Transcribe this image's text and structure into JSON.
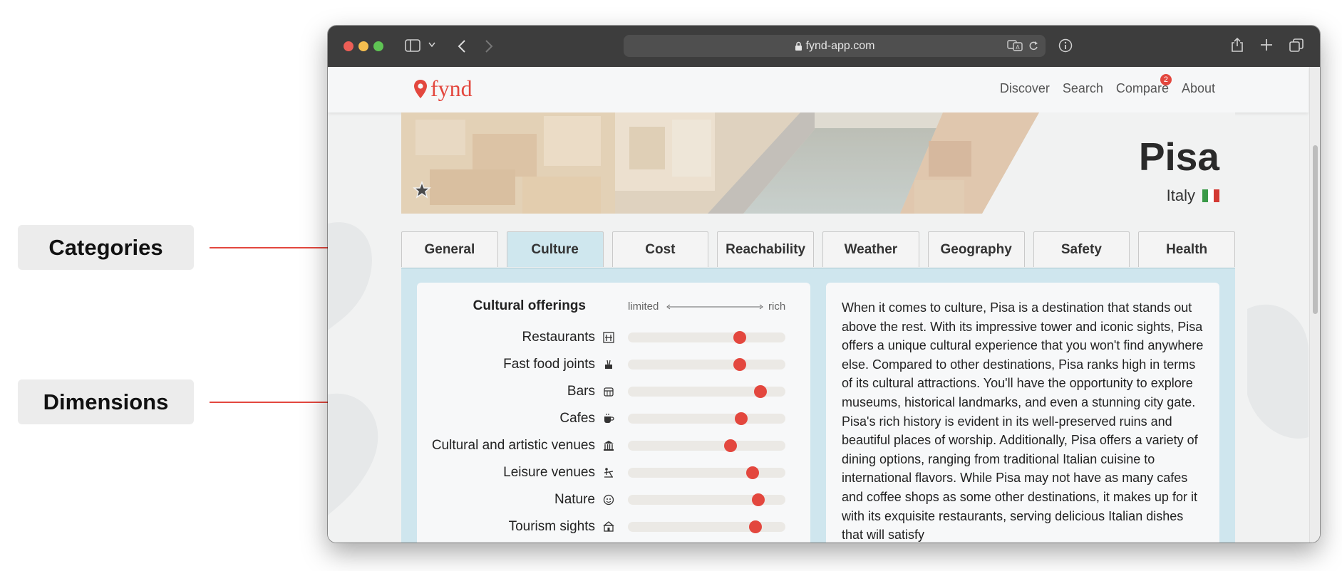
{
  "annotations": {
    "categories_label": "Categories",
    "dimensions_label": "Dimensions"
  },
  "browser": {
    "url": "fynd-app.com"
  },
  "site": {
    "logo_text": "fynd",
    "nav": [
      {
        "label": "Discover"
      },
      {
        "label": "Search"
      },
      {
        "label": "Compare",
        "badge": "2"
      },
      {
        "label": "About"
      }
    ]
  },
  "destination": {
    "city": "Pisa",
    "country": "Italy",
    "flag_colors": [
      "#3a9a48",
      "#ffffff",
      "#d33a34"
    ]
  },
  "tabs": [
    {
      "label": "General",
      "active": false
    },
    {
      "label": "Culture",
      "active": true
    },
    {
      "label": "Cost",
      "active": false
    },
    {
      "label": "Reachability",
      "active": false
    },
    {
      "label": "Weather",
      "active": false
    },
    {
      "label": "Geography",
      "active": false
    },
    {
      "label": "Safety",
      "active": false
    },
    {
      "label": "Health",
      "active": false
    }
  ],
  "offerings": {
    "title": "Cultural offerings",
    "scale_min": "limited",
    "scale_max": "rich",
    "dimensions": [
      {
        "label": "Restaurants",
        "icon": "restaurant-icon",
        "value": 0.71
      },
      {
        "label": "Fast food joints",
        "icon": "fast-food-icon",
        "value": 0.71
      },
      {
        "label": "Bars",
        "icon": "bar-icon",
        "value": 0.84
      },
      {
        "label": "Cafes",
        "icon": "coffee-cup-icon",
        "value": 0.72
      },
      {
        "label": "Cultural and artistic venues",
        "icon": "museum-icon",
        "value": 0.65
      },
      {
        "label": "Leisure venues",
        "icon": "playground-icon",
        "value": 0.79
      },
      {
        "label": "Nature",
        "icon": "nature-icon",
        "value": 0.83
      },
      {
        "label": "Tourism sights",
        "icon": "sightseeing-icon",
        "value": 0.81
      }
    ]
  },
  "description": "When it comes to culture, Pisa is a destination that stands out above the rest. With its impressive tower and iconic sights, Pisa offers a unique cultural experience that you won't find anywhere else. Compared to other destinations, Pisa ranks high in terms of its cultural attractions. You'll have the opportunity to explore museums, historical landmarks, and even a stunning city gate. Pisa's rich history is evident in its well-preserved ruins and beautiful places of worship. Additionally, Pisa offers a variety of dining options, ranging from traditional Italian cuisine to international flavors. While Pisa may not have as many cafes and coffee shops as some other destinations, it makes up for it with its exquisite restaurants, serving delicious Italian dishes that will satisfy",
  "colors": {
    "accent": "#e3473e",
    "active_tab": "#cfe7ee",
    "content_bg": "#cfe6ee"
  }
}
